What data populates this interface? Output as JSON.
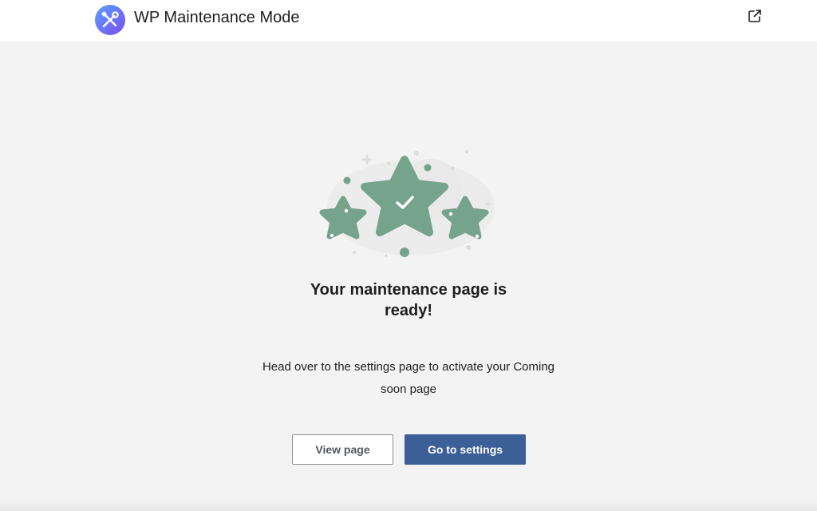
{
  "header": {
    "title": "WP Maintenance Mode",
    "logo_icon": "wrench-screwdriver-icon",
    "external_link_icon": "external-link-icon"
  },
  "main": {
    "illustration_icon": "stars-check-icon",
    "heading": "Your maintenance page is ready!",
    "description": "Head over to the settings page to activate your Coming soon page",
    "buttons": {
      "view_page": "View page",
      "go_to_settings": "Go to settings"
    }
  },
  "colors": {
    "accent": "#3c5f97",
    "star": "#76a38c",
    "logo_gradient_start": "#5aa0ff",
    "logo_gradient_end": "#7a4df0"
  }
}
